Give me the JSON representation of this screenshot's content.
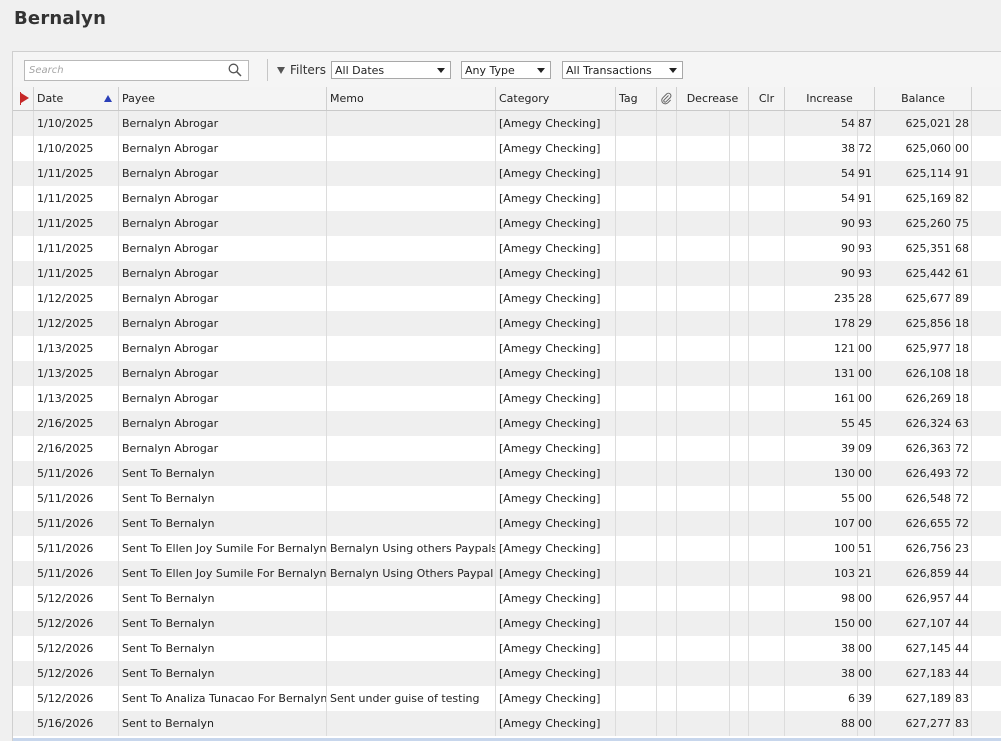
{
  "page_title": "Bernalyn",
  "toolbar": {
    "search_placeholder": "Search",
    "filters_label": "Filters",
    "dates_value": "All Dates",
    "type_value": "Any Type",
    "transactions_value": "All Transactions"
  },
  "columns": {
    "date": "Date",
    "payee": "Payee",
    "memo": "Memo",
    "category": "Category",
    "tag": "Tag",
    "decrease": "Decrease",
    "clr": "Clr",
    "increase": "Increase",
    "balance": "Balance"
  },
  "rows": [
    {
      "date": "1/10/2025",
      "payee": "Bernalyn Abrogar",
      "memo": "",
      "category": "[Amegy Checking]",
      "inc_d": "54",
      "inc_c": "87",
      "bal_d": "625,021",
      "bal_c": "28"
    },
    {
      "date": "1/10/2025",
      "payee": "Bernalyn Abrogar",
      "memo": "",
      "category": "[Amegy Checking]",
      "inc_d": "38",
      "inc_c": "72",
      "bal_d": "625,060",
      "bal_c": "00"
    },
    {
      "date": "1/11/2025",
      "payee": "Bernalyn Abrogar",
      "memo": "",
      "category": "[Amegy Checking]",
      "inc_d": "54",
      "inc_c": "91",
      "bal_d": "625,114",
      "bal_c": "91"
    },
    {
      "date": "1/11/2025",
      "payee": "Bernalyn Abrogar",
      "memo": "",
      "category": "[Amegy Checking]",
      "inc_d": "54",
      "inc_c": "91",
      "bal_d": "625,169",
      "bal_c": "82"
    },
    {
      "date": "1/11/2025",
      "payee": "Bernalyn Abrogar",
      "memo": "",
      "category": "[Amegy Checking]",
      "inc_d": "90",
      "inc_c": "93",
      "bal_d": "625,260",
      "bal_c": "75"
    },
    {
      "date": "1/11/2025",
      "payee": "Bernalyn Abrogar",
      "memo": "",
      "category": "[Amegy Checking]",
      "inc_d": "90",
      "inc_c": "93",
      "bal_d": "625,351",
      "bal_c": "68"
    },
    {
      "date": "1/11/2025",
      "payee": "Bernalyn Abrogar",
      "memo": "",
      "category": "[Amegy Checking]",
      "inc_d": "90",
      "inc_c": "93",
      "bal_d": "625,442",
      "bal_c": "61"
    },
    {
      "date": "1/12/2025",
      "payee": "Bernalyn Abrogar",
      "memo": "",
      "category": "[Amegy Checking]",
      "inc_d": "235",
      "inc_c": "28",
      "bal_d": "625,677",
      "bal_c": "89"
    },
    {
      "date": "1/12/2025",
      "payee": "Bernalyn Abrogar",
      "memo": "",
      "category": "[Amegy Checking]",
      "inc_d": "178",
      "inc_c": "29",
      "bal_d": "625,856",
      "bal_c": "18"
    },
    {
      "date": "1/13/2025",
      "payee": "Bernalyn Abrogar",
      "memo": "",
      "category": "[Amegy Checking]",
      "inc_d": "121",
      "inc_c": "00",
      "bal_d": "625,977",
      "bal_c": "18"
    },
    {
      "date": "1/13/2025",
      "payee": "Bernalyn Abrogar",
      "memo": "",
      "category": "[Amegy Checking]",
      "inc_d": "131",
      "inc_c": "00",
      "bal_d": "626,108",
      "bal_c": "18"
    },
    {
      "date": "1/13/2025",
      "payee": "Bernalyn Abrogar",
      "memo": "",
      "category": "[Amegy Checking]",
      "inc_d": "161",
      "inc_c": "00",
      "bal_d": "626,269",
      "bal_c": "18"
    },
    {
      "date": "2/16/2025",
      "payee": "Bernalyn Abrogar",
      "memo": "",
      "category": "[Amegy Checking]",
      "inc_d": "55",
      "inc_c": "45",
      "bal_d": "626,324",
      "bal_c": "63"
    },
    {
      "date": "2/16/2025",
      "payee": "Bernalyn Abrogar",
      "memo": "",
      "category": "[Amegy Checking]",
      "inc_d": "39",
      "inc_c": "09",
      "bal_d": "626,363",
      "bal_c": "72"
    },
    {
      "date": "5/11/2026",
      "payee": "Sent To Bernalyn",
      "memo": "",
      "category": "[Amegy Checking]",
      "inc_d": "130",
      "inc_c": "00",
      "bal_d": "626,493",
      "bal_c": "72"
    },
    {
      "date": "5/11/2026",
      "payee": "Sent To Bernalyn",
      "memo": "",
      "category": "[Amegy Checking]",
      "inc_d": "55",
      "inc_c": "00",
      "bal_d": "626,548",
      "bal_c": "72"
    },
    {
      "date": "5/11/2026",
      "payee": "Sent To Bernalyn",
      "memo": "",
      "category": "[Amegy Checking]",
      "inc_d": "107",
      "inc_c": "00",
      "bal_d": "626,655",
      "bal_c": "72"
    },
    {
      "date": "5/11/2026",
      "payee": "Sent To Ellen Joy Sumile For Bernalyn",
      "memo": "Bernalyn Using others Paypals",
      "category": "[Amegy Checking]",
      "inc_d": "100",
      "inc_c": "51",
      "bal_d": "626,756",
      "bal_c": "23"
    },
    {
      "date": "5/11/2026",
      "payee": "Sent To Ellen Joy Sumile For Bernalyn",
      "memo": "Bernalyn Using Others Paypal",
      "category": "[Amegy Checking]",
      "inc_d": "103",
      "inc_c": "21",
      "bal_d": "626,859",
      "bal_c": "44"
    },
    {
      "date": "5/12/2026",
      "payee": "Sent To Bernalyn",
      "memo": "",
      "category": "[Amegy Checking]",
      "inc_d": "98",
      "inc_c": "00",
      "bal_d": "626,957",
      "bal_c": "44"
    },
    {
      "date": "5/12/2026",
      "payee": "Sent To Bernalyn",
      "memo": "",
      "category": "[Amegy Checking]",
      "inc_d": "150",
      "inc_c": "00",
      "bal_d": "627,107",
      "bal_c": "44"
    },
    {
      "date": "5/12/2026",
      "payee": "Sent To Bernalyn",
      "memo": "",
      "category": "[Amegy Checking]",
      "inc_d": "38",
      "inc_c": "00",
      "bal_d": "627,145",
      "bal_c": "44"
    },
    {
      "date": "5/12/2026",
      "payee": "Sent To Bernalyn",
      "memo": "",
      "category": "[Amegy Checking]",
      "inc_d": "38",
      "inc_c": "00",
      "bal_d": "627,183",
      "bal_c": "44"
    },
    {
      "date": "5/12/2026",
      "payee": "Sent To Analiza Tunacao For Bernalyn",
      "memo": "Sent under guise of testing",
      "category": "[Amegy Checking]",
      "inc_d": "6",
      "inc_c": "39",
      "bal_d": "627,189",
      "bal_c": "83"
    },
    {
      "date": "5/16/2026",
      "payee": "Sent to Bernalyn",
      "memo": "",
      "category": "[Amegy Checking]",
      "inc_d": "88",
      "inc_c": "00",
      "bal_d": "627,277",
      "bal_c": "83"
    }
  ]
}
